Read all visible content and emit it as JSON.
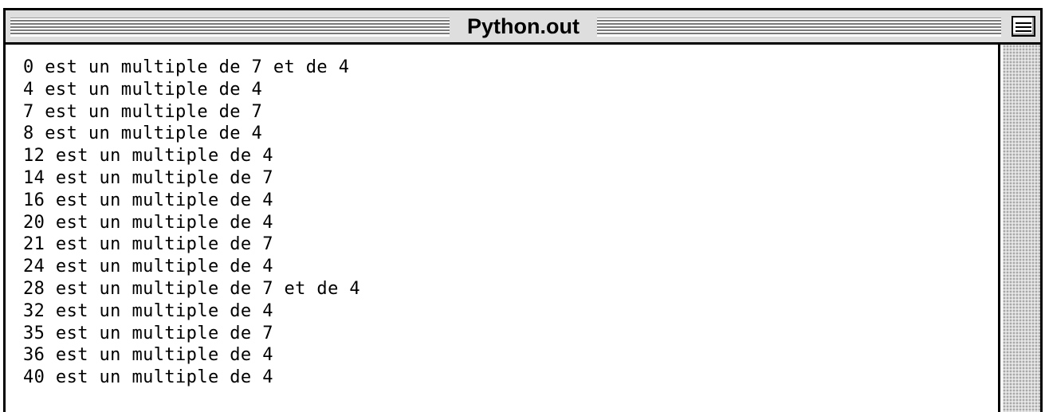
{
  "window": {
    "title": "Python.out"
  },
  "output": {
    "lines": [
      "0 est un multiple de 7 et de 4",
      "4 est un multiple de 4",
      "7 est un multiple de 7",
      "8 est un multiple de 4",
      "12 est un multiple de 4",
      "14 est un multiple de 7",
      "16 est un multiple de 4",
      "20 est un multiple de 4",
      "21 est un multiple de 7",
      "24 est un multiple de 4",
      "28 est un multiple de 7 et de 4",
      "32 est un multiple de 4",
      "35 est un multiple de 7",
      "36 est un multiple de 4",
      "40 est un multiple de 4"
    ]
  },
  "icons": {
    "collapse_box": "window-collapse-icon"
  },
  "colors": {
    "titlebar": "#dedede",
    "border": "#000000",
    "background": "#ffffff",
    "text": "#000000"
  }
}
